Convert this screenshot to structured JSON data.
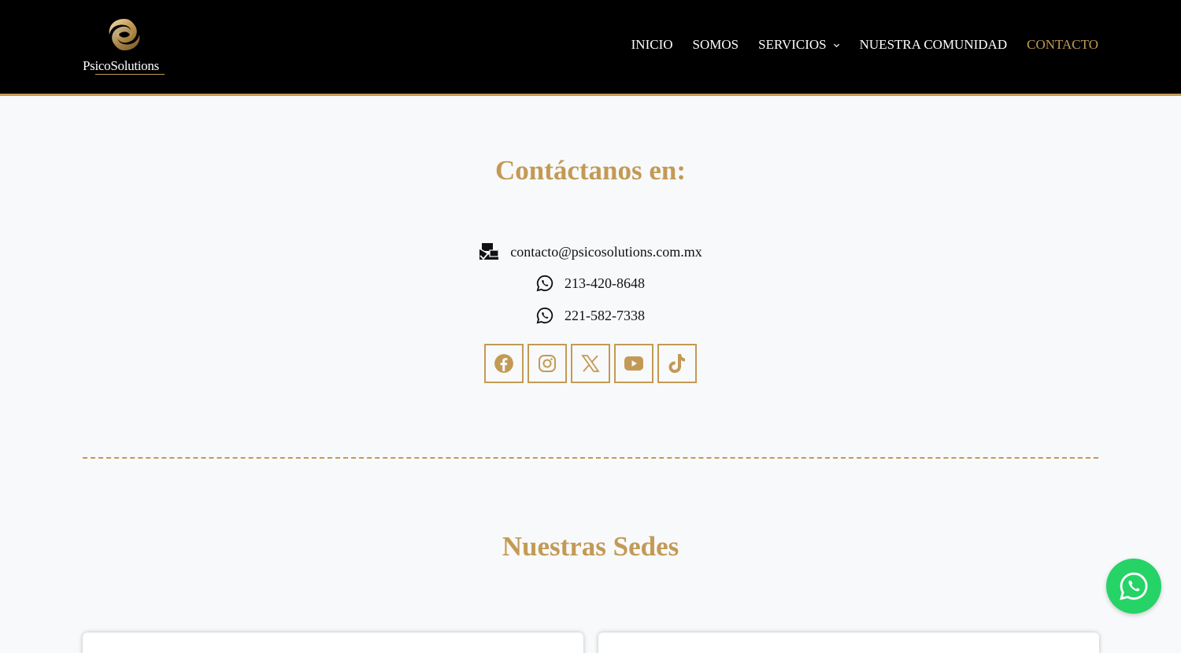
{
  "brand": {
    "logo_text_prefix": "Psico",
    "logo_text_suffix": "Solutions",
    "accent_color": "#c39a55",
    "header_bg": "#000000"
  },
  "nav": {
    "items": [
      {
        "label": "INICIO",
        "active": false
      },
      {
        "label": "SOMOS",
        "active": false
      },
      {
        "label": "SERVICIOS",
        "active": false,
        "has_dropdown": true
      },
      {
        "label": "NUESTRA COMUNIDAD",
        "active": false
      },
      {
        "label": "CONTACTO",
        "active": true
      }
    ]
  },
  "contact": {
    "title": "Contáctanos en:",
    "email": "contacto@psicosolutions.com.mx",
    "phones": [
      "213-420-8648",
      "221-582-7338"
    ],
    "social_icons": [
      "facebook-icon",
      "instagram-icon",
      "x-icon",
      "youtube-icon",
      "tiktok-icon"
    ]
  },
  "sedes": {
    "title": "Nuestras Sedes"
  },
  "whatsapp_float": {
    "icon": "whatsapp-icon",
    "color": "#25d366"
  }
}
